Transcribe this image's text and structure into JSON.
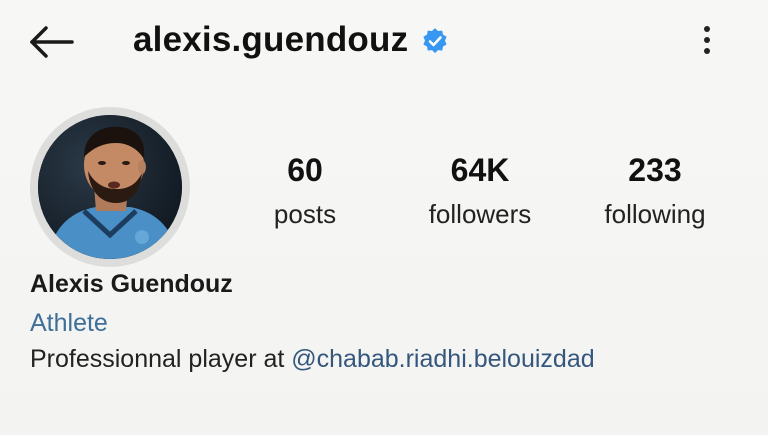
{
  "header": {
    "username": "alexis.guendouz",
    "back_icon": "arrow-left-icon",
    "verified_icon": "verified-badge-icon",
    "more_icon": "more-vertical-icon"
  },
  "stats": {
    "posts": {
      "value": "60",
      "label": "posts"
    },
    "followers": {
      "value": "64K",
      "label": "followers"
    },
    "following": {
      "value": "233",
      "label": "following"
    }
  },
  "profile": {
    "full_name": "Alexis Guendouz",
    "category": "Athlete",
    "bio_text": "Professionnal player at ",
    "bio_mention": "@chabab.riadhi.belouizdad"
  },
  "colors": {
    "verified": "#3897f0",
    "category": "#3e6f99",
    "mention": "#35577e"
  }
}
